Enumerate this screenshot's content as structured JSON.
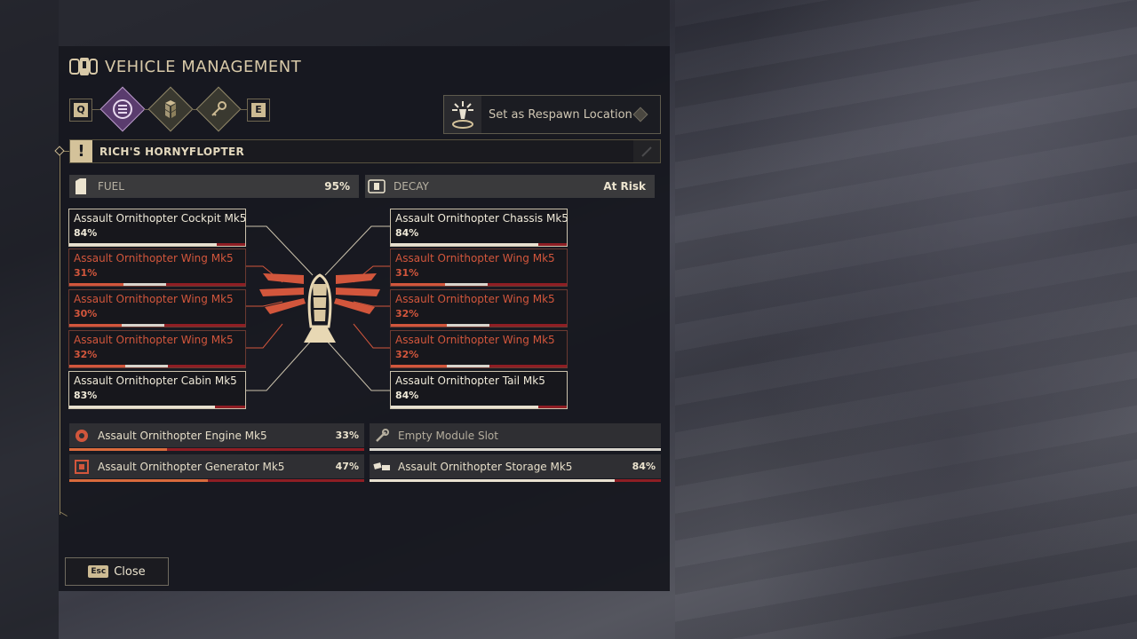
{
  "header": {
    "title": "VEHICLE MANAGEMENT",
    "title_icon": "vehicle-key-icon"
  },
  "tabs": {
    "prev_key": "Q",
    "next_key": "E",
    "items": [
      {
        "icon": "inventory-list-icon",
        "active": true
      },
      {
        "icon": "modules-cubes-icon",
        "active": false
      },
      {
        "icon": "access-key-icon",
        "active": false
      }
    ]
  },
  "respawn": {
    "label": "Set as Respawn Location",
    "icon": "respawn-beacon-icon"
  },
  "vehicle": {
    "name": "RICH'S HORNYFLOPTER",
    "warning_symbol": "!"
  },
  "stats": {
    "fuel_label": "FUEL",
    "fuel_value": "95%",
    "decay_label": "DECAY",
    "decay_value": "At Risk"
  },
  "parts": {
    "left": [
      {
        "name": "Assault Ornithopter Cockpit Mk5",
        "pct": "84%",
        "health": 0.84,
        "status": "ok"
      },
      {
        "name": "Assault Ornithopter Wing Mk5",
        "pct": "31%",
        "health": 0.31,
        "status": "damaged"
      },
      {
        "name": "Assault Ornithopter Wing Mk5",
        "pct": "30%",
        "health": 0.3,
        "status": "damaged"
      },
      {
        "name": "Assault Ornithopter Wing Mk5",
        "pct": "32%",
        "health": 0.32,
        "status": "damaged"
      },
      {
        "name": "Assault Ornithopter Cabin Mk5",
        "pct": "83%",
        "health": 0.83,
        "status": "ok"
      }
    ],
    "right": [
      {
        "name": "Assault Ornithopter Chassis Mk5",
        "pct": "84%",
        "health": 0.84,
        "status": "ok"
      },
      {
        "name": "Assault Ornithopter Wing Mk5",
        "pct": "31%",
        "health": 0.31,
        "status": "damaged"
      },
      {
        "name": "Assault Ornithopter Wing Mk5",
        "pct": "32%",
        "health": 0.32,
        "status": "damaged"
      },
      {
        "name": "Assault Ornithopter Wing Mk5",
        "pct": "32%",
        "health": 0.32,
        "status": "damaged"
      },
      {
        "name": "Assault Ornithopter Tail Mk5",
        "pct": "84%",
        "health": 0.84,
        "status": "ok"
      }
    ]
  },
  "modules": {
    "engine": {
      "name": "Assault Ornithopter Engine Mk5",
      "pct": "33%",
      "health": 0.33,
      "icon": "engine-icon"
    },
    "empty_slot": {
      "name": "Empty Module Slot",
      "icon": "wrench-icon"
    },
    "generator": {
      "name": "Assault Ornithopter Generator Mk5",
      "pct": "47%",
      "health": 0.47,
      "icon": "generator-icon"
    },
    "storage": {
      "name": "Assault Ornithopter Storage Mk5",
      "pct": "84%",
      "health": 0.84,
      "icon": "storage-icon"
    }
  },
  "footer": {
    "close_key": "Esc",
    "close_label": "Close"
  },
  "colors": {
    "accent_gold": "#cdbb93",
    "damaged": "#d2563c",
    "health_red": "#8f1e24",
    "active_tab": "#5a3c6e"
  }
}
